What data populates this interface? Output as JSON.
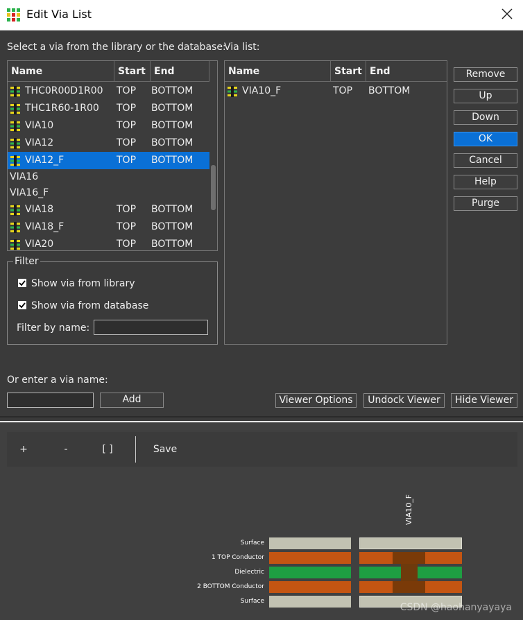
{
  "window": {
    "title": "Edit Via List",
    "app_icon": "via-app-icon",
    "close_icon": "close-icon"
  },
  "library": {
    "label": "Select a via from the library or the database:",
    "columns": [
      "Name",
      "Start",
      "End"
    ],
    "rows": [
      {
        "name": "THC0R00D1R00",
        "start": "TOP",
        "end": "BOTTOM",
        "icon": true,
        "selected": false
      },
      {
        "name": "THC1R60-1R00",
        "start": "TOP",
        "end": "BOTTOM",
        "icon": true,
        "selected": false
      },
      {
        "name": "VIA10",
        "start": "TOP",
        "end": "BOTTOM",
        "icon": true,
        "selected": false
      },
      {
        "name": "VIA12",
        "start": "TOP",
        "end": "BOTTOM",
        "icon": true,
        "selected": false
      },
      {
        "name": "VIA12_F",
        "start": "TOP",
        "end": "BOTTOM",
        "icon": true,
        "selected": true
      },
      {
        "name": "VIA16",
        "start": "",
        "end": "",
        "icon": false,
        "selected": false
      },
      {
        "name": "VIA16_F",
        "start": "",
        "end": "",
        "icon": false,
        "selected": false
      },
      {
        "name": "VIA18",
        "start": "TOP",
        "end": "BOTTOM",
        "icon": true,
        "selected": false
      },
      {
        "name": "VIA18_F",
        "start": "TOP",
        "end": "BOTTOM",
        "icon": true,
        "selected": false
      },
      {
        "name": "VIA20",
        "start": "TOP",
        "end": "BOTTOM",
        "icon": true,
        "selected": false
      }
    ]
  },
  "via_list": {
    "label": "Via list:",
    "columns": [
      "Name",
      "Start",
      "End"
    ],
    "rows": [
      {
        "name": "VIA10_F",
        "start": "TOP",
        "end": "BOTTOM",
        "icon": true
      }
    ]
  },
  "buttons": {
    "remove": "Remove",
    "up": "Up",
    "down": "Down",
    "ok": "OK",
    "cancel": "Cancel",
    "help": "Help",
    "purge": "Purge"
  },
  "filter": {
    "title": "Filter",
    "show_library": "Show via from library",
    "show_library_checked": true,
    "show_database": "Show via from database",
    "show_database_checked": true,
    "filter_by_name_label": "Filter by name:",
    "filter_by_name_value": ""
  },
  "enter_via": {
    "label": "Or enter a via name:",
    "value": "",
    "add_button": "Add"
  },
  "viewer_buttons": {
    "options": "Viewer Options",
    "undock": "Undock Viewer",
    "hide": "Hide Viewer"
  },
  "viewer_toolbar": {
    "zoom_in": "+",
    "zoom_out": "-",
    "fit": "[ ]",
    "save": "Save"
  },
  "stackup": {
    "via_name": "VIA10_F",
    "layers": [
      {
        "label": "Surface",
        "type": "surface"
      },
      {
        "label": "1   TOP Conductor",
        "type": "conductor"
      },
      {
        "label": "Dielectric",
        "type": "dielectric"
      },
      {
        "label": "2   BOTTOM Conductor",
        "type": "conductor"
      },
      {
        "label": "Surface",
        "type": "surface"
      }
    ],
    "colors": {
      "surface": "#c2c2b2",
      "conductor": "#c45512",
      "dielectric": "#1e9e42",
      "via_pad": "#7a3a08",
      "via_barrel": "#6e3a0c"
    }
  },
  "watermark": "CSDN @haohanyayaya"
}
